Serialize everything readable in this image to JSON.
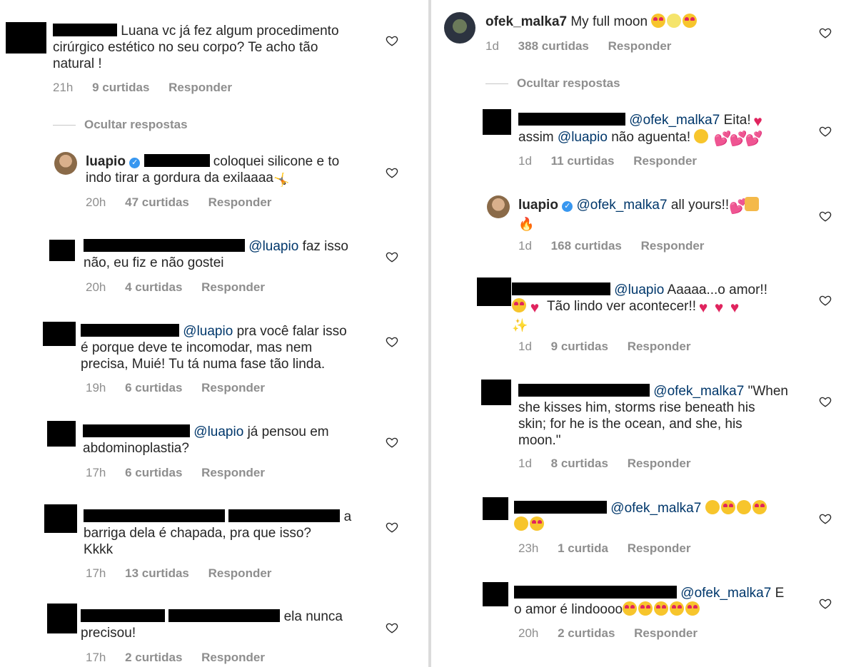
{
  "left": {
    "c1": {
      "text": "Luana vc já fez algum procedimento",
      "text2": "cirúrgico estético no seu corpo? Te acho tão",
      "text3": "natural !",
      "time": "21h",
      "likes": "9 curtidas",
      "reply": "Responder"
    },
    "hide": "Ocultar respostas",
    "c2": {
      "user": "luapio",
      "text": "coloquei silicone e to",
      "text2": "indo tirar a gordura da exilaaaa",
      "time": "20h",
      "likes": "47 curtidas",
      "reply": "Responder"
    },
    "c3": {
      "mention": "@luapio",
      "text": "faz isso",
      "text2": "não, eu fiz e não gostei",
      "time": "20h",
      "likes": "4 curtidas",
      "reply": "Responder"
    },
    "c4": {
      "mention": "@luapio",
      "text": "pra você falar isso",
      "text2": "é porque deve te incomodar, mas nem",
      "text3": "precisa, Muié! Tu tá numa fase tão linda.",
      "time": "19h",
      "likes": "6 curtidas",
      "reply": "Responder"
    },
    "c5": {
      "mention": "@luapio",
      "text": "já pensou em",
      "text2": "abdominoplastia?",
      "time": "17h",
      "likes": "6 curtidas",
      "reply": "Responder"
    },
    "c6": {
      "text": "a",
      "text2": "barriga dela é chapada, pra que isso?",
      "text3": "Kkkk",
      "time": "17h",
      "likes": "13 curtidas",
      "reply": "Responder"
    },
    "c7": {
      "text": "ela nunca",
      "text2": "precisou!",
      "time": "17h",
      "likes": "2 curtidas",
      "reply": "Responder"
    }
  },
  "right": {
    "c1": {
      "user": "ofek_malka7",
      "text": "My full moon",
      "time": "1d",
      "likes": "388 curtidas",
      "reply": "Responder"
    },
    "hide": "Ocultar respostas",
    "c2": {
      "mention": "@ofek_malka7",
      "text": "Eita!",
      "text2a": "assim",
      "mention2": "@luapio",
      "text2b": "não aguenta!",
      "time": "1d",
      "likes": "11 curtidas",
      "reply": "Responder"
    },
    "c3": {
      "user": "luapio",
      "mention": "@ofek_malka7",
      "text": "all yours!!",
      "time": "1d",
      "likes": "168 curtidas",
      "reply": "Responder"
    },
    "c4": {
      "mention": "@luapio",
      "text": "Aaaaa...o amor!!",
      "text2": "Tão lindo ver acontecer!!",
      "time": "1d",
      "likes": "9 curtidas",
      "reply": "Responder"
    },
    "c5": {
      "mention": "@ofek_malka7",
      "text": "\"When",
      "text2": "she kisses him, storms rise beneath his",
      "text3": "skin; for he is the ocean, and she, his",
      "text4": "moon.\"",
      "time": "1d",
      "likes": "8 curtidas",
      "reply": "Responder"
    },
    "c6": {
      "mention": "@ofek_malka7",
      "time": "23h",
      "likes": "1 curtida",
      "reply": "Responder"
    },
    "c7": {
      "mention": "@ofek_malka7",
      "text": "E",
      "text2": "o amor é lindoooo",
      "time": "20h",
      "likes": "2 curtidas",
      "reply": "Responder"
    }
  },
  "icons": {
    "like": "heart-outline-icon",
    "verified": "verified-badge-icon"
  },
  "colors": {
    "mention": "#00376b",
    "meta": "#8e8e8e",
    "verified": "#3897f0"
  }
}
